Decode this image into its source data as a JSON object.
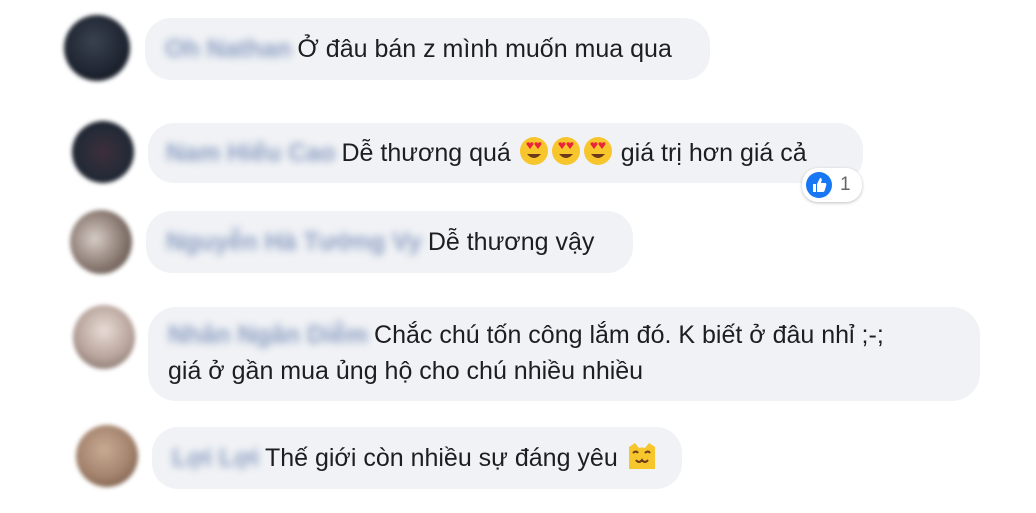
{
  "comments": [
    {
      "author": "Oh Nathan",
      "text": "Ở đâu bán z mình muốn mua qua",
      "avatar_color": "#1e2430"
    },
    {
      "author": "Nam Hiếu Cao",
      "text_before": "Dễ thương quá",
      "emojis": [
        "heart-eyes-emoji",
        "heart-eyes-emoji",
        "heart-eyes-emoji"
      ],
      "text_after": "giá trị hơn giá cả",
      "reaction": {
        "icon": "like-icon",
        "count": "1"
      },
      "avatar_color": "#252b38"
    },
    {
      "author": "Nguyễn Hà Tường Vy",
      "text": "Dễ thương vậy",
      "avatar_color": "#8a7a72"
    },
    {
      "author": "Nhân Ngân Diễm",
      "lines": [
        "Chắc chú tốn công lắm đó. K biết ở đâu nhỉ ;-;",
        "giá ở gần mua ủng hộ cho chú nhiều nhiều"
      ],
      "avatar_color": "#b8a49c"
    },
    {
      "author": "Lợi Lợi",
      "text": "Thế giới còn nhiều sự đáng yêu",
      "emoji": "smiling-cat-emoji",
      "avatar_color": "#a3826c"
    }
  ]
}
